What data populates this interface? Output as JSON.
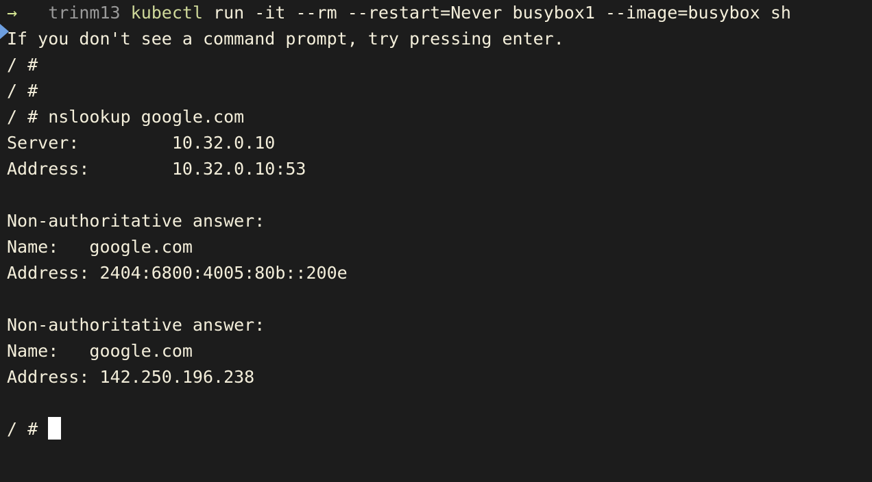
{
  "terminal": {
    "background_color": "#1c1c1c",
    "foreground_color": "#f3eeda",
    "host_color": "#9a9a9a",
    "command_color": "#cfd99a",
    "arrow_color": "#d7e894",
    "triangle_color": "#6d9fe0",
    "cursor_color": "#ffffff",
    "prompt": {
      "triangle_glyph": "▶",
      "arrow_glyph": "→",
      "host": "trinm13",
      "shell_prompt": "/ #"
    },
    "lines": [
      {
        "id": "line-1",
        "type": "command",
        "arrow": "→",
        "host": "trinm13",
        "command_name": "kubectl",
        "command_args": " run -it --rm --restart=Never busybox1 --image=busybox sh"
      },
      {
        "id": "line-2",
        "type": "output",
        "text": "If you don't see a command prompt, try pressing enter."
      },
      {
        "id": "line-3",
        "type": "prompt",
        "text": "/ #"
      },
      {
        "id": "line-4",
        "type": "prompt",
        "text": "/ #"
      },
      {
        "id": "line-5",
        "type": "prompt-command",
        "text": "/ # nslookup google.com"
      },
      {
        "id": "line-6",
        "type": "output",
        "text": "Server:         10.32.0.10"
      },
      {
        "id": "line-7",
        "type": "output",
        "text": "Address:        10.32.0.10:53"
      },
      {
        "id": "line-8",
        "type": "blank",
        "text": " "
      },
      {
        "id": "line-9",
        "type": "output",
        "text": "Non-authoritative answer:"
      },
      {
        "id": "line-10",
        "type": "output",
        "text": "Name:   google.com"
      },
      {
        "id": "line-11",
        "type": "output",
        "text": "Address: 2404:6800:4005:80b::200e"
      },
      {
        "id": "line-12",
        "type": "blank",
        "text": " "
      },
      {
        "id": "line-13",
        "type": "output",
        "text": "Non-authoritative answer:"
      },
      {
        "id": "line-14",
        "type": "output",
        "text": "Name:   google.com"
      },
      {
        "id": "line-15",
        "type": "output",
        "text": "Address: 142.250.196.238"
      },
      {
        "id": "line-16",
        "type": "blank",
        "text": " "
      },
      {
        "id": "line-17",
        "type": "prompt-cursor",
        "text": "/ # "
      }
    ]
  }
}
